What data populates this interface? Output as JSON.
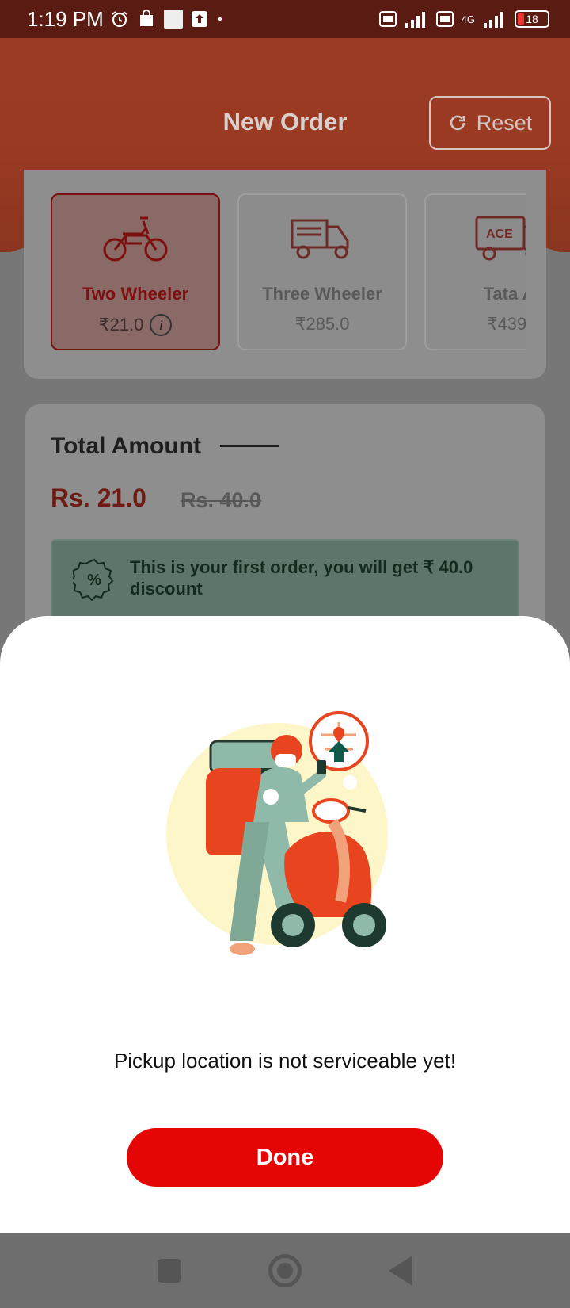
{
  "status_bar": {
    "time": "1:19 PM",
    "battery": "18",
    "network": "4G"
  },
  "header": {
    "title": "New Order",
    "reset_label": "Reset"
  },
  "vehicles": [
    {
      "name": "Two Wheeler",
      "price": "₹21.0",
      "icon": "motorcycle-icon",
      "selected": true
    },
    {
      "name": "Three Wheeler",
      "price": "₹285.0",
      "icon": "three-wheeler-icon",
      "selected": false
    },
    {
      "name": "Tata A",
      "price": "₹439.",
      "icon": "tata-ace-icon",
      "selected": false,
      "badge": "ACE"
    }
  ],
  "total": {
    "title": "Total Amount",
    "price_now": "Rs. 21.0",
    "price_old": "Rs. 40.0",
    "discount_text": "This is your first order, you will get ₹ 40.0 discount"
  },
  "sheet": {
    "message": "Pickup location is not serviceable yet!",
    "done_label": "Done"
  },
  "colors": {
    "accent": "#e60505",
    "header": "#9a3c24"
  }
}
